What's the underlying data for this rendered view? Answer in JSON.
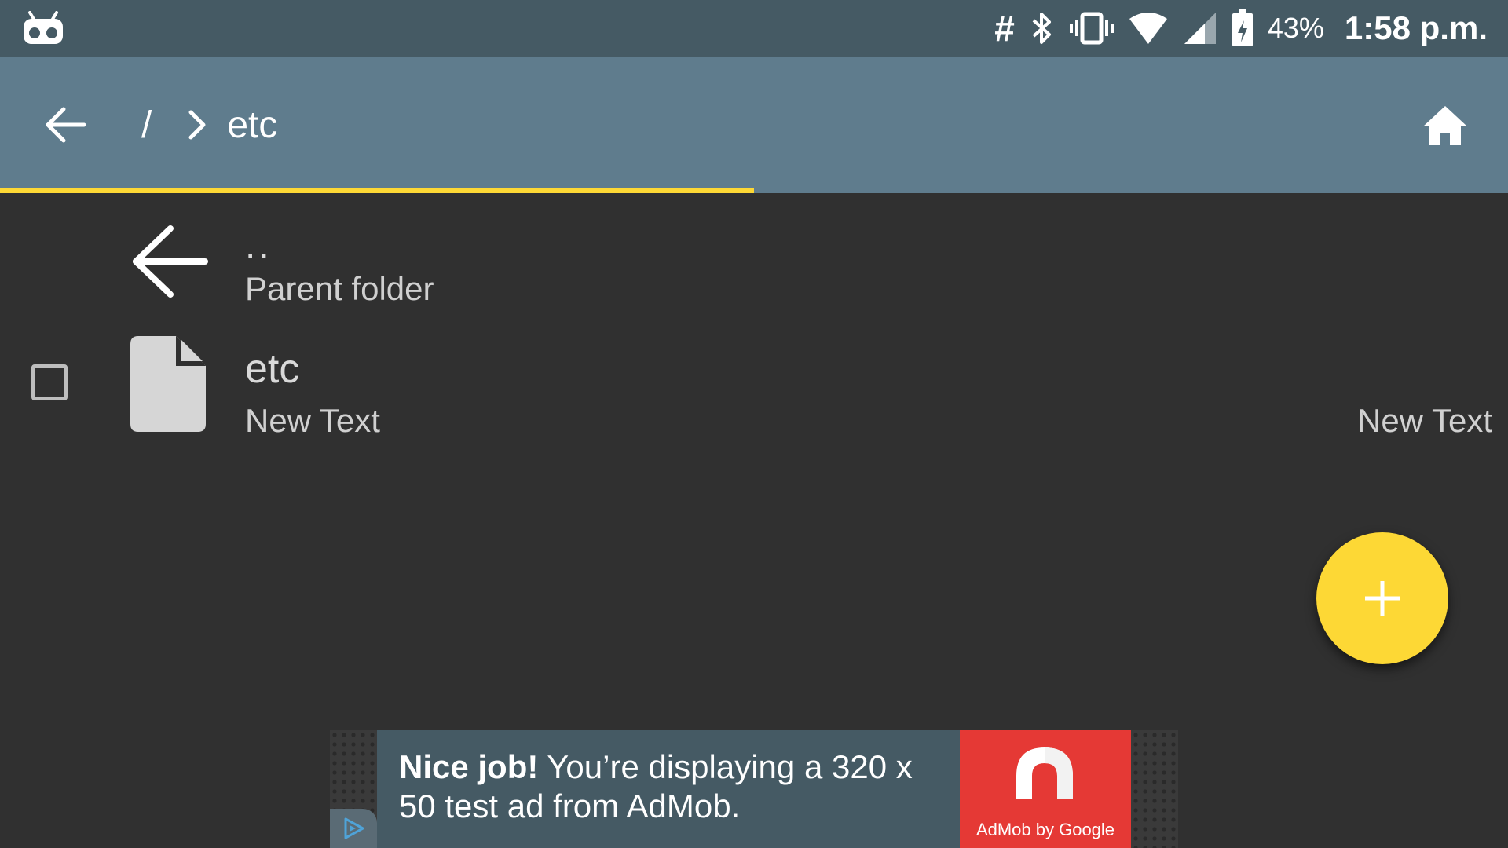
{
  "status_bar": {
    "hash_glyph": "#",
    "battery_percent": "43%",
    "time": "1:58 p.m.",
    "icons": [
      "cyanogen-robot-icon",
      "bluetooth-icon",
      "vibrate-icon",
      "wifi-icon",
      "cell-signal-icon",
      "battery-icon"
    ]
  },
  "app_bar": {
    "breadcrumb_root": "/",
    "breadcrumb_current": "etc",
    "load_progress": 0.5,
    "icons": [
      "back-arrow-icon",
      "chevron-right-icon",
      "home-icon"
    ]
  },
  "list": {
    "parent": {
      "title": "..",
      "subtitle": "Parent folder"
    },
    "file": {
      "name": "etc",
      "subtitle": "New Text",
      "right_text": "New Text"
    }
  },
  "fab": {
    "symbol": "+"
  },
  "ad": {
    "headline_bold": "Nice job!",
    "headline_rest": " You’re displaying a 320 x 50 test ad from AdMob.",
    "logo_caption": "AdMob by Google"
  },
  "colors": {
    "status_bar": "#455a64",
    "app_bar": "#5f7c8d",
    "accent": "#fdd835",
    "background": "#303030",
    "ad_red": "#e53935"
  }
}
